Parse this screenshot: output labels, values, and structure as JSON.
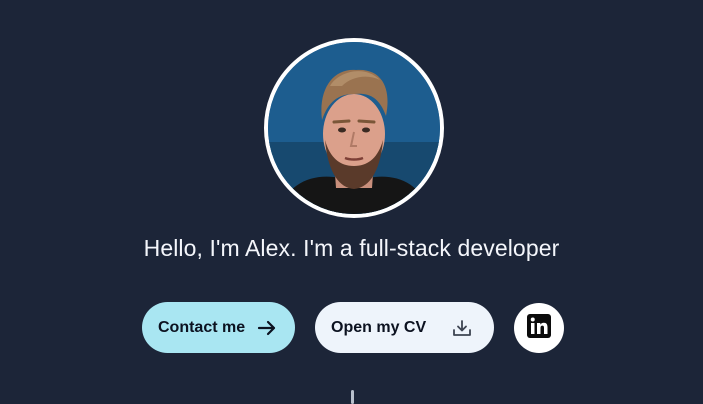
{
  "hero": {
    "headline": "Hello, I'm Alex. I'm a full-stack developer",
    "avatar_alt": "Alex portrait"
  },
  "actions": {
    "contact_label": "Contact me",
    "cv_label": "Open my CV",
    "contact_icon": "arrow-right-icon",
    "cv_icon": "download-icon",
    "linkedin_icon": "linkedin-icon"
  },
  "colors": {
    "background": "#1c2538",
    "contact_button": "#a9e6f2",
    "cv_button": "#eef4fb",
    "linkedin_button": "#ffffff",
    "headline_text": "#f4f6fb"
  }
}
